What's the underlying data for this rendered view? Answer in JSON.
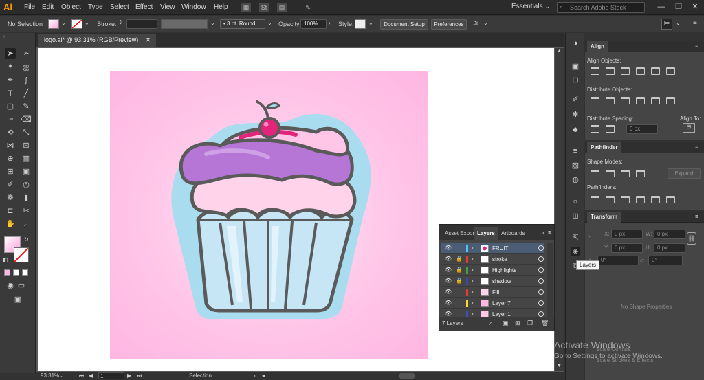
{
  "app": {
    "logo": "Ai",
    "workspace": "Essentials",
    "search_placeholder": "Search Adobe Stock"
  },
  "menu": [
    "File",
    "Edit",
    "Object",
    "Type",
    "Select",
    "Effect",
    "View",
    "Window",
    "Help"
  ],
  "menu_mini": [
    "St"
  ],
  "control": {
    "selection_label": "No Selection",
    "stroke_label": "Stroke:",
    "brush_value": "3 pt. Round",
    "opacity_label": "Opacity:",
    "opacity_value": "100%",
    "style_label": "Style:",
    "document_setup": "Document Setup",
    "preferences": "Preferences"
  },
  "document": {
    "tab_title": "logo.ai* @ 93.31% (RGB/Preview)",
    "zoom": "93.31%",
    "artboard_number": "1",
    "status_text": "Selection"
  },
  "align_panel": {
    "title": "Align",
    "align_objects": "Align Objects:",
    "distribute_objects": "Distribute Objects:",
    "distribute_spacing": "Distribute Spacing:",
    "align_to": "Align To:",
    "spacing_value": "0 px"
  },
  "pathfinder_panel": {
    "title": "Pathfinder",
    "shape_modes": "Shape Modes:",
    "pathfinders": "Pathfinders:",
    "expand": "Expand"
  },
  "transform_panel": {
    "title": "Transform",
    "x_label": "X:",
    "y_label": "Y:",
    "w_label": "W:",
    "h_label": "H:",
    "zero": "0 px",
    "angle_value": "0°",
    "no_shape": "No Shape Properties",
    "scale_corners": "Scale Corners",
    "scale_strokes": "Scale Strokes & Effects"
  },
  "layers_panel": {
    "tabs": [
      "Asset Expor",
      "Layers",
      "Artboards"
    ],
    "count_label": "7 Layers",
    "layers": [
      {
        "name": "FRUIT",
        "color": "#4fc3f7",
        "locked": false,
        "selected": true
      },
      {
        "name": "stroke",
        "color": "#e53935",
        "locked": true,
        "selected": false
      },
      {
        "name": "Highlights",
        "color": "#43a047",
        "locked": true,
        "selected": false
      },
      {
        "name": "shadow",
        "color": "#3949ab",
        "locked": true,
        "selected": false
      },
      {
        "name": "Fill",
        "color": "#e53935",
        "locked": false,
        "selected": false
      },
      {
        "name": "Layer 7",
        "color": "#fdd835",
        "locked": false,
        "selected": false
      },
      {
        "name": "Layer 1",
        "color": "#3f51b5",
        "locked": false,
        "selected": false
      }
    ]
  },
  "tooltip": "Layers",
  "watermark": {
    "line1": "Activate Windows",
    "line2": "Go to Settings to activate Windows."
  },
  "colors": {
    "artboard_pink": "#ffc6e8",
    "frosting_purple": "#b676d6",
    "cup_blue": "#bfe1f2",
    "cherry": "#e2247a",
    "outline": "#5a5a5a"
  }
}
